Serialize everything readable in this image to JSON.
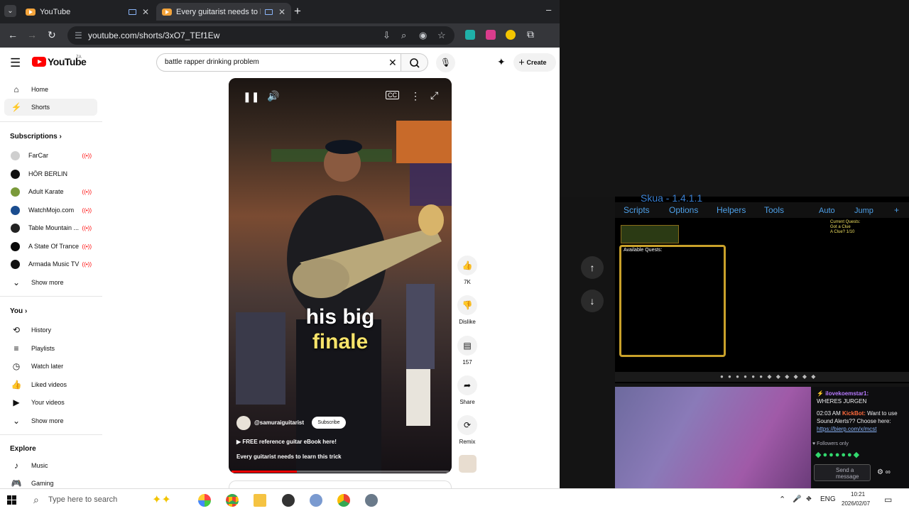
{
  "browser": {
    "tabs": [
      {
        "title": "YouTube"
      },
      {
        "title": "Every guitarist needs to lea"
      }
    ],
    "new_tab": "+",
    "minimize": "–",
    "url": "youtube.com/shorts/3xO7_TEf1Ew"
  },
  "youtube": {
    "logo_text": "YouTube",
    "country": "ZA",
    "search_query": "battle rapper drinking problem",
    "create_label": "Create",
    "sidebar": {
      "home": "Home",
      "shorts": "Shorts",
      "subscriptions_heading": "Subscriptions",
      "subscriptions": [
        {
          "name": "FarCar",
          "avatar_color": "#cfcfcf"
        },
        {
          "name": "HÖR BERLIN",
          "avatar_color": "#111111"
        },
        {
          "name": "Adult Karate",
          "avatar_color": "#7a9a3a"
        },
        {
          "name": "WatchMojo.com",
          "avatar_color": "#1b4d8f"
        },
        {
          "name": "Table Mountain ...",
          "avatar_color": "#222222"
        },
        {
          "name": "A State Of Trance",
          "avatar_color": "#0a0a0a"
        },
        {
          "name": "Armada Music TV",
          "avatar_color": "#111111"
        }
      ],
      "show_more_subs": "Show more",
      "you_heading": "You",
      "you_items": [
        "History",
        "Playlists",
        "Watch later",
        "Liked videos",
        "Your videos"
      ],
      "show_more_you": "Show more",
      "explore_heading": "Explore",
      "explore_items": [
        "Music",
        "Gaming"
      ]
    },
    "short": {
      "caption_line1": "his big",
      "caption_line2": "finale",
      "channel": "@samuraiguitarist",
      "subscribe": "Subscribe",
      "promo": "▶ FREE reference guitar eBook here!",
      "title": "Every guitarist needs to learn this trick",
      "progress_fraction": 0.3
    },
    "actions": {
      "likes": "7K",
      "dislike": "Dislike",
      "comments": "157",
      "share": "Share",
      "remix": "Remix"
    }
  },
  "game": {
    "title": "Skua - 1.4.1.1",
    "menu": [
      "Scripts",
      "Options",
      "Helpers",
      "Tools",
      "Auto",
      "Jump",
      "+"
    ],
    "available_quests": "Available Quests:",
    "current_quests": "Current Quests:",
    "current_quest_name": "Got a Clue",
    "current_quest_progress": "A Clue? 1/10"
  },
  "stream_chat": {
    "user1": "ilovekoemstar1:",
    "msg1": "WHERES JURGEN",
    "time2": "02:03 AM",
    "bot": "KickBot:",
    "msg2": "Want to use Sound Alerts?? Choose here:",
    "link": "https://bierp.com/x/mcst",
    "followers_only": "Followers only",
    "input_placeholder": "Send a message"
  },
  "taskbar": {
    "search_placeholder": "Type here to search",
    "lang": "ENG",
    "time": "10:21",
    "date": "2026/02/07"
  }
}
